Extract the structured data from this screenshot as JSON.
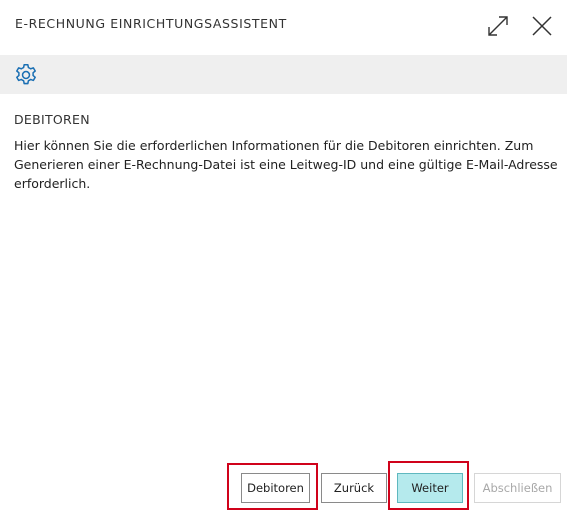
{
  "dialog": {
    "title": "E-RECHNUNG EINRICHTUNGSASSISTENT",
    "expand_icon": "expand-icon",
    "close_icon": "close-icon"
  },
  "toolbar": {
    "settings_icon": "gear-icon",
    "accent_color": "#1a6fb3"
  },
  "content": {
    "heading": "DEBITOREN",
    "description": "Hier können Sie die erforderlichen Informationen für die Debitoren einrichten. Zum Generieren einer E-Rechnung-Datei ist eine Leitweg-ID und eine gültige E-Mail-Adresse erforderlich."
  },
  "footer": {
    "debitoren_label": "Debitoren",
    "back_label": "Zurück",
    "next_label": "Weiter",
    "finish_label": "Abschließen"
  },
  "colors": {
    "primary_button_bg": "#b5eaed",
    "highlight_border": "#d0021b"
  }
}
